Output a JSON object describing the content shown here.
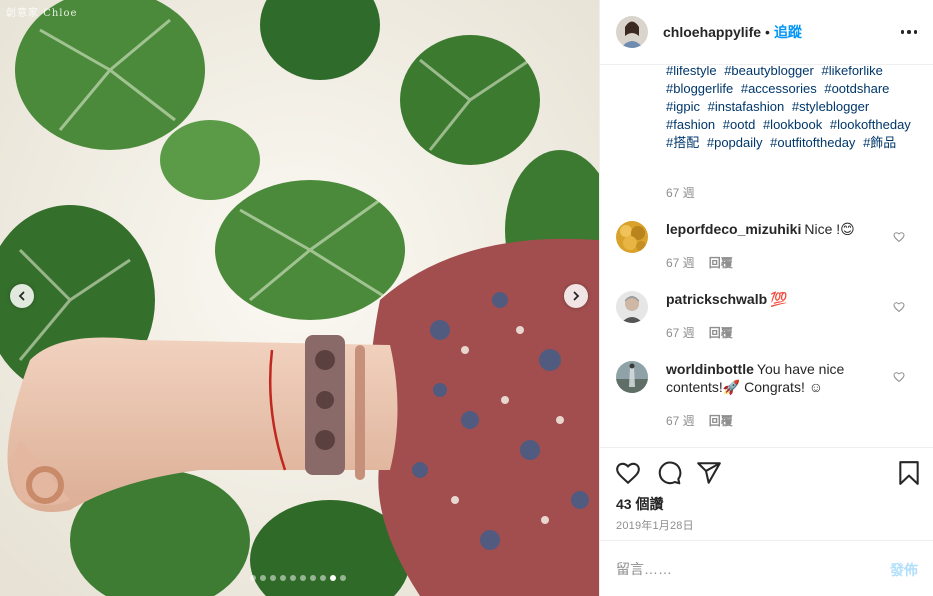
{
  "photo": {
    "watermark": "創意家 Chloe",
    "prev_icon": "chevron-left-icon",
    "next_icon": "chevron-right-icon",
    "carousel_count": 10,
    "carousel_active_index": 8
  },
  "header": {
    "username": "chloehappylife",
    "separator": "•",
    "follow_label": "追蹤",
    "more_icon": "more-horizontal-icon"
  },
  "caption": {
    "hashtags": [
      "#lifestyle",
      "#beautyblogger",
      "#likeforlike",
      "#bloggerlife",
      "#accessories",
      "#ootdshare",
      "#igpic",
      "#instafashion",
      "#styleblogger",
      "#fashion",
      "#ootd",
      "#lookbook",
      "#lookoftheday",
      "#搭配",
      "#popdaily",
      "#outfitoftheday",
      "#飾品"
    ],
    "time": "67 週"
  },
  "comments": [
    {
      "username": "leporfdeco_mizuhiki",
      "text": "Nice !😊",
      "time": "67 週",
      "reply_label": "回覆"
    },
    {
      "username": "patrickschwalb",
      "text": "💯",
      "time": "67 週",
      "reply_label": "回覆"
    },
    {
      "username": "worldinbottle",
      "text": "You have nice contents!🚀 Congrats! ☺",
      "time": "67 週",
      "reply_label": "回覆"
    }
  ],
  "actions": {
    "like_icon": "heart-icon",
    "comment_icon": "comment-icon",
    "share_icon": "share-icon",
    "save_icon": "bookmark-icon",
    "likes": "43 個讚",
    "date": "2019年1月28日"
  },
  "comment_box": {
    "placeholder": "留言……",
    "post_label": "發佈"
  },
  "colors": {
    "link": "#00376b",
    "follow": "#0095f6",
    "muted": "#8e8e8e",
    "post_disabled": "#b2dffc"
  }
}
